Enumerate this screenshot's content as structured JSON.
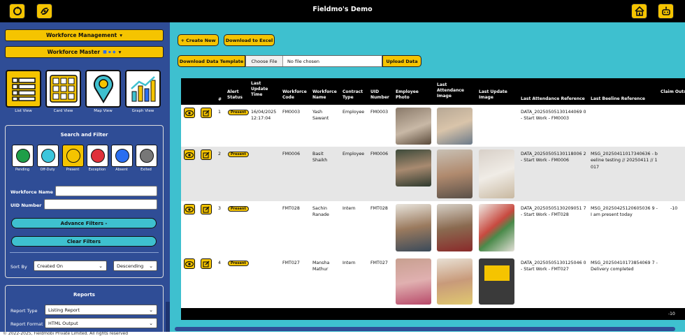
{
  "app": {
    "title": "Fieldmo's Demo"
  },
  "icons": {
    "refresh": "refresh-icon",
    "sync": "sync-icon",
    "home": "home-icon",
    "robot": "robot-icon"
  },
  "sidebar": {
    "workforce_management": "Workforce Management",
    "workforce_master": "Workforce Master",
    "views": [
      {
        "label": "List View",
        "icon": "list-icon"
      },
      {
        "label": "Card View",
        "icon": "grid-icon"
      },
      {
        "label": "Map View",
        "icon": "map-pin-icon"
      },
      {
        "label": "Graph View",
        "icon": "chart-icon"
      }
    ],
    "search_filter": {
      "title": "Search and Filter",
      "statuses": [
        {
          "label": "Pending",
          "color": "#1e9e48"
        },
        {
          "label": "Off-Duty",
          "color": "#3cc6dc"
        },
        {
          "label": "Present",
          "color": "#f5c400"
        },
        {
          "label": "Exception",
          "color": "#e0303a"
        },
        {
          "label": "Absent",
          "color": "#2a6ef0"
        },
        {
          "label": "Exited",
          "color": "#777777"
        }
      ],
      "workforce_name_label": "Workforce Name",
      "uid_number_label": "UID Number",
      "advance_filters": "Advance Filters -",
      "clear_filters": "Clear Filters",
      "sort_by_label": "Sort By",
      "sort_by_value": "Created On",
      "sort_order_value": "Descending"
    },
    "reports": {
      "title": "Reports",
      "report_type_label": "Report Type",
      "report_type_value": "Listing Report",
      "report_format_label": "Report Format",
      "report_format_value": "HTML Output"
    }
  },
  "toolbar": {
    "create_new": "+ Create New",
    "download_excel": "Download to Excel",
    "download_template": "Download Data Template",
    "choose_file": "Choose File",
    "no_file": "No file chosen",
    "upload_data": "Upload Data"
  },
  "table": {
    "headers": [
      "#",
      "Alert Status",
      "Last Update Time",
      "Workforce Code",
      "Workforce Name",
      "Contract Type",
      "UID Number",
      "Employee Photo",
      "Last Attendance Image",
      "Last Update Image",
      "Last Attendance Reference",
      "Last Beeline Reference",
      "Claim Outst"
    ],
    "rows": [
      {
        "num": "1",
        "status": "Present",
        "time": "16/04/2025 12:17:04",
        "code": "FM0003",
        "name": "Yash Sawant",
        "contract": "Employee",
        "uid": "FM0003",
        "att_ref": "DATA_20250505130144069 0 - Start Work - FM0003",
        "beeline": "",
        "claim": ""
      },
      {
        "num": "2",
        "status": "Present",
        "time": "",
        "code": "FM0006",
        "name": "Basit Shaikh",
        "contract": "Employee",
        "uid": "FM0006",
        "att_ref": "DATA_20250505130118006 2 - Start Work - FM0006",
        "beeline": "MSG_20250411017340636 - beeline testing // 20250411 // 1017",
        "claim": ""
      },
      {
        "num": "3",
        "status": "Present",
        "time": "",
        "code": "FMT028",
        "name": "Sachin Ranade",
        "contract": "Intern",
        "uid": "FMT028",
        "att_ref": "DATA_20250505130209051 7 - Start Work - FMT028",
        "beeline": "MSG_20250425120605036 9 - I am present today",
        "claim": "-10"
      },
      {
        "num": "4",
        "status": "Present",
        "time": "",
        "code": "FMT027",
        "name": "Mansha Mathur",
        "contract": "Intern",
        "uid": "FMT027",
        "att_ref": "DATA_20250505130125046 0 - Start Work - FMT027",
        "beeline": "MSG_20250410173854069 7 - Delivery completed",
        "claim": ""
      }
    ],
    "footer_value": "-10"
  },
  "footer": {
    "copyright": "© 2022-2025, Fieldmobi Private Limited. All rights reserved"
  }
}
